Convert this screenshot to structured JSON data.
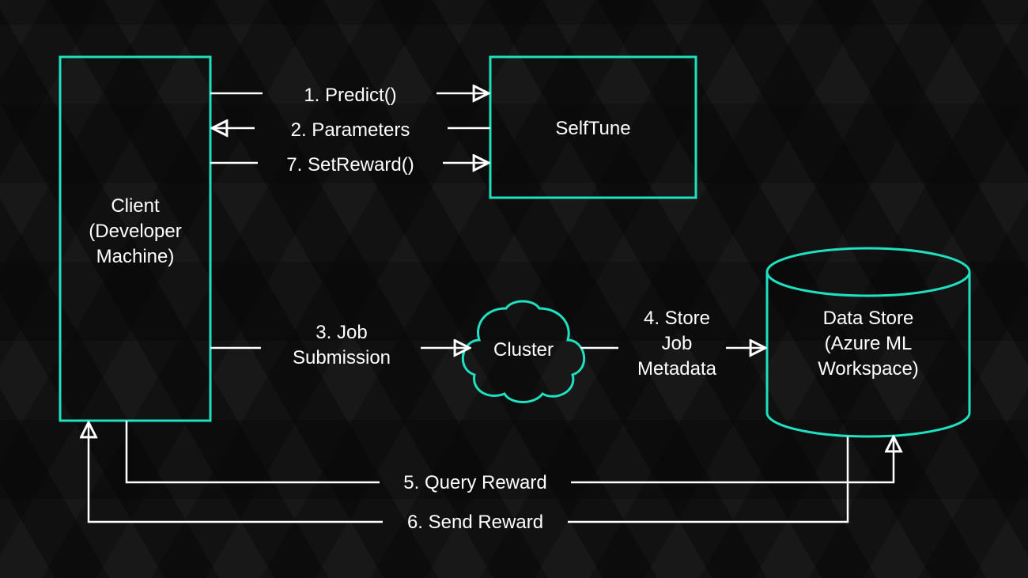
{
  "accent_color": "#1fe0c0",
  "line_color": "#ffffff",
  "nodes": {
    "client_l1": "Client",
    "client_l2": "(Developer",
    "client_l3": "Machine)",
    "selftune": "SelfTune",
    "cluster": "Cluster",
    "datastore_l1": "Data Store",
    "datastore_l2": "(Azure ML",
    "datastore_l3": "Workspace)"
  },
  "edges": {
    "predict": "1. Predict()",
    "parameters": "2. Parameters",
    "setreward": "7. SetReward()",
    "job_l1": "3. Job",
    "job_l2": "Submission",
    "store_l1": "4. Store",
    "store_l2": "Job",
    "store_l3": "Metadata",
    "query": "5. Query Reward",
    "send": "6. Send Reward"
  }
}
